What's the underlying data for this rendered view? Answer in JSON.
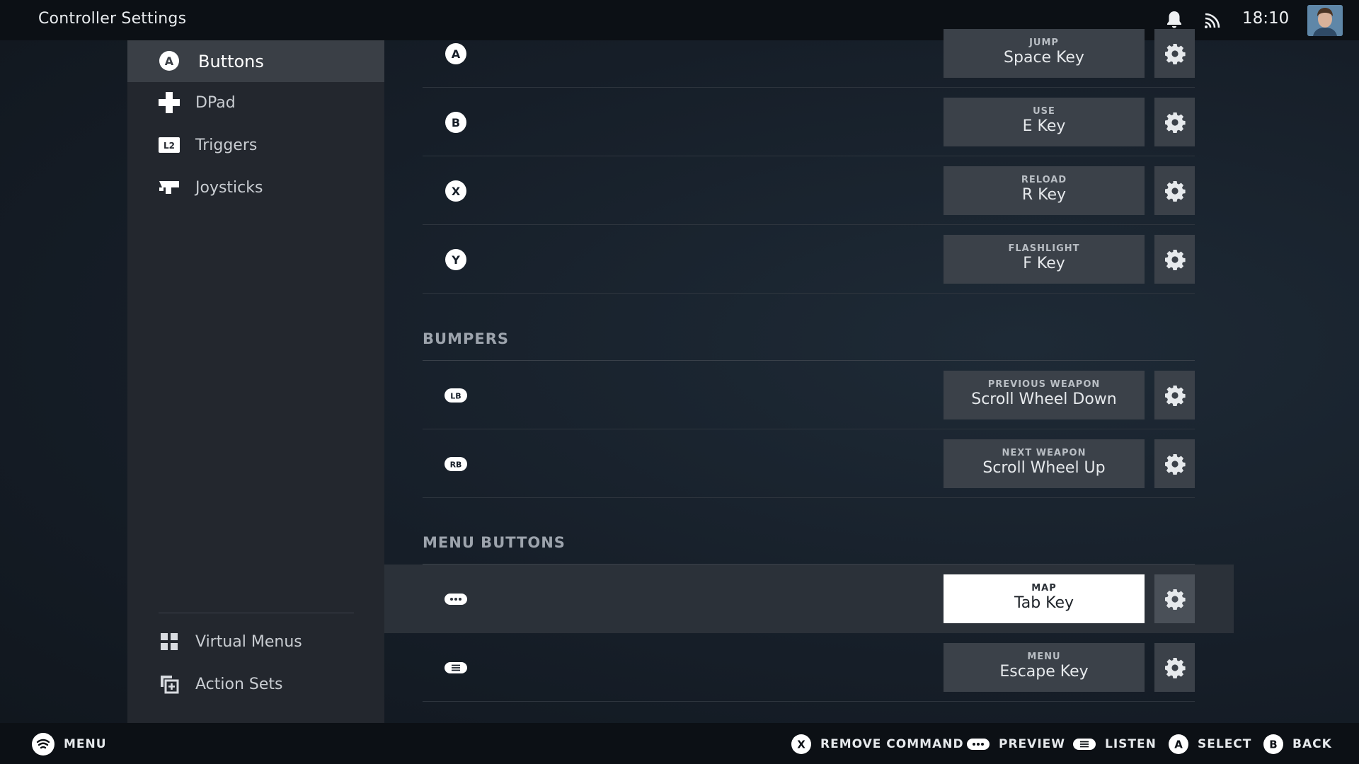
{
  "header": {
    "title": "Controller Settings",
    "time": "18:10"
  },
  "sidebar": {
    "items": [
      {
        "label": "Buttons",
        "icon": "a-button-icon",
        "active": true
      },
      {
        "label": "DPad",
        "icon": "dpad-icon"
      },
      {
        "label": "Triggers",
        "icon": "l2-trigger-icon"
      },
      {
        "label": "Joysticks",
        "icon": "joystick-icon"
      }
    ],
    "bottom_items": [
      {
        "label": "Virtual Menus",
        "icon": "grid-icon"
      },
      {
        "label": "Action Sets",
        "icon": "action-sets-icon"
      }
    ],
    "badge": {
      "l2": "L2"
    }
  },
  "face_buttons": [
    {
      "glyph": "A",
      "action": "JUMP",
      "key": "Space Key"
    },
    {
      "glyph": "B",
      "action": "USE",
      "key": "E Key"
    },
    {
      "glyph": "X",
      "action": "RELOAD",
      "key": "R Key"
    },
    {
      "glyph": "Y",
      "action": "FLASHLIGHT",
      "key": "F Key"
    }
  ],
  "bumpers": {
    "title": "BUMPERS",
    "rows": [
      {
        "glyph": "LB",
        "action": "PREVIOUS WEAPON",
        "key": "Scroll Wheel Down"
      },
      {
        "glyph": "RB",
        "action": "NEXT WEAPON",
        "key": "Scroll Wheel Up"
      }
    ]
  },
  "menu_buttons": {
    "title": "MENU BUTTONS",
    "rows": [
      {
        "glyph": "view-button-icon",
        "action": "MAP",
        "key": "Tab Key",
        "selected": true
      },
      {
        "glyph": "menu-button-icon",
        "action": "MENU",
        "key": "Escape Key"
      }
    ]
  },
  "footer": {
    "menu": "MENU",
    "hints": [
      {
        "glyph": "X",
        "label": "REMOVE COMMAND"
      },
      {
        "glyph": "view-button-icon",
        "label": "PREVIEW"
      },
      {
        "glyph": "menu-button-icon",
        "label": "LISTEN"
      },
      {
        "glyph": "A",
        "label": "SELECT"
      },
      {
        "glyph": "B",
        "label": "BACK"
      }
    ]
  },
  "colors": {
    "background": "#161e28",
    "topbar": "#0c1015",
    "sidebar": "#23272e",
    "sidebar_active": "#3a3f46",
    "binding_box": "#3b4149",
    "binding_box_selected": "#ffffff"
  }
}
